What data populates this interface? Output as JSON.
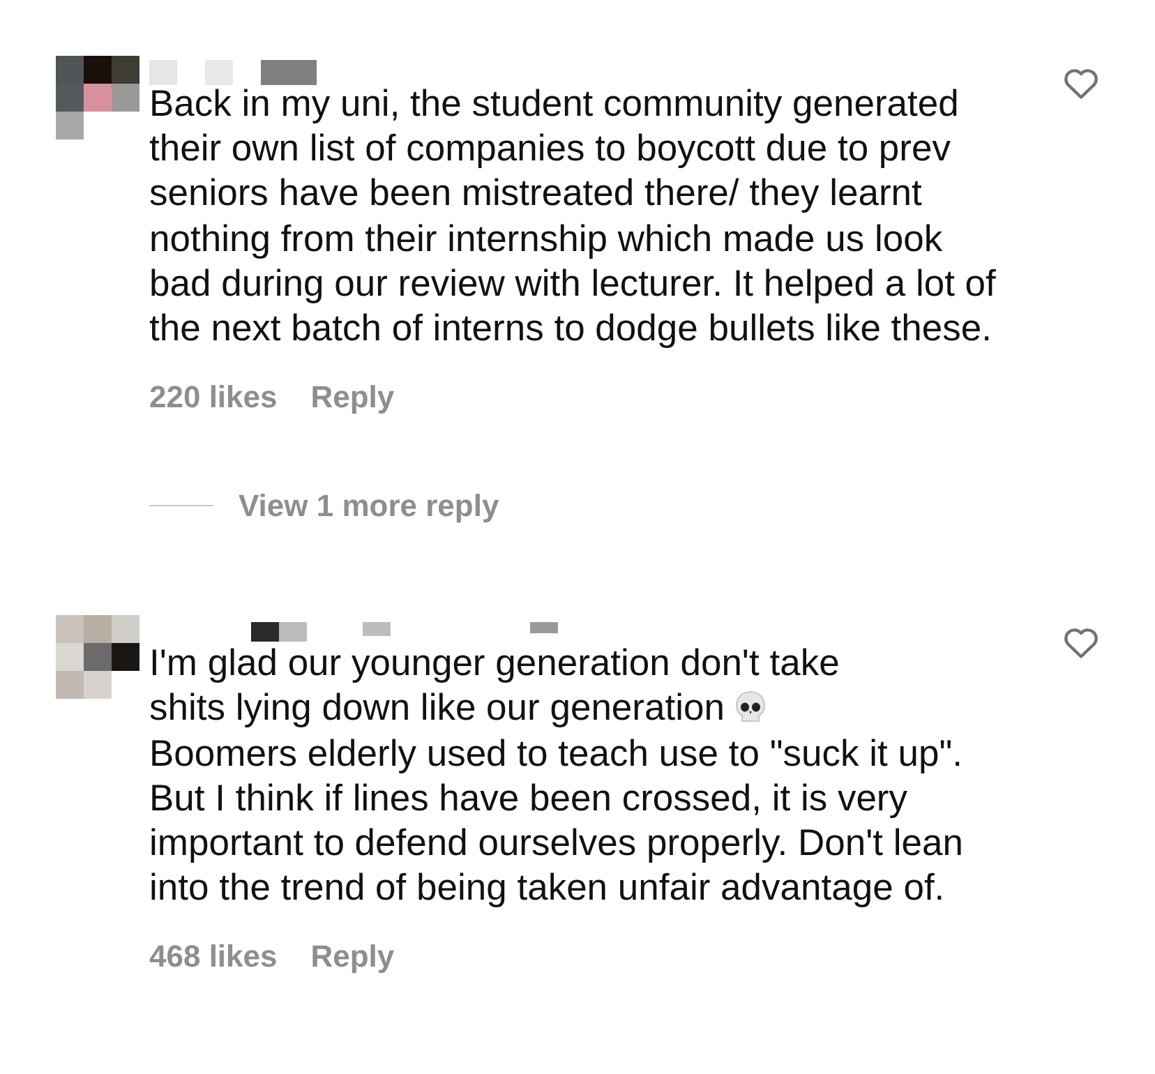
{
  "comments": [
    {
      "liked": false,
      "segments": [
        {
          "kind": "text",
          "text": "Back in my uni, the student community generated their own list of companies to boycott due to prev seniors have been mistreated there/ they learnt nothing from their internship which made us look bad during our review with lecturer. It helped a lot of the next batch of interns to dodge bullets like these."
        }
      ],
      "likes": "220 likes",
      "reply": "Reply",
      "more_replies": "View 1 more reply"
    },
    {
      "liked": false,
      "segments": [
        {
          "kind": "text",
          "text": "I'm glad our younger generation don't take"
        },
        {
          "kind": "text",
          "text": "shits lying down like our generation"
        },
        {
          "kind": "skull"
        },
        {
          "kind": "text",
          "text": "Boomers elderly used to teach use to \"suck it up\". But I think if lines have been crossed, it is very important to defend ourselves properly. Don't lean into the trend of being taken unfair advantage of."
        }
      ],
      "likes": "468 likes",
      "reply": "Reply"
    }
  ]
}
